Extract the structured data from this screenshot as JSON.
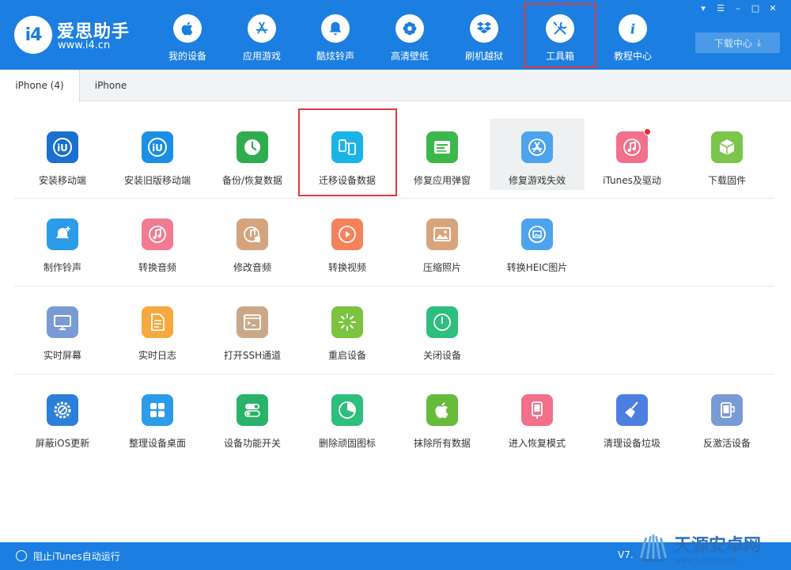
{
  "brand": {
    "name": "爱思助手",
    "url": "www.i4.cn",
    "logo_text": "i4"
  },
  "nav": [
    {
      "label": "我的设备",
      "icon": "apple-icon"
    },
    {
      "label": "应用游戏",
      "icon": "app-store-icon"
    },
    {
      "label": "酷炫铃声",
      "icon": "bell-icon"
    },
    {
      "label": "高清壁纸",
      "icon": "flower-icon"
    },
    {
      "label": "刷机越狱",
      "icon": "box-icon"
    },
    {
      "label": "工具箱",
      "icon": "tools-icon",
      "active": true
    },
    {
      "label": "教程中心",
      "icon": "info-icon"
    }
  ],
  "window_controls": [
    "shirt-icon",
    "menu-icon",
    "minimize-icon",
    "maximize-icon",
    "close-icon"
  ],
  "download_center": {
    "label": "下载中心"
  },
  "tabs": [
    {
      "label": "iPhone (4)",
      "active": true
    },
    {
      "label": "iPhone",
      "active": false
    }
  ],
  "tools": {
    "row1": [
      {
        "label": "安装移动端",
        "icon": "i4-icon",
        "color": "#1a6fcf"
      },
      {
        "label": "安装旧版移动端",
        "icon": "i4-icon",
        "color": "#1b8fe6"
      },
      {
        "label": "备份/恢复数据",
        "icon": "backup-clock-icon",
        "color": "#2fad4e"
      },
      {
        "label": "迁移设备数据",
        "icon": "phone-transfer-icon",
        "color": "#19b4e8"
      },
      {
        "label": "修复应用弹窗",
        "icon": "apple-id-icon",
        "color": "#3bb84a"
      },
      {
        "label": "修复游戏失效",
        "icon": "app-store-icon",
        "color": "#4ea3ee"
      },
      {
        "label": "iTunes及驱动",
        "icon": "music-settings-icon",
        "color": "#f27089",
        "badge": true
      },
      {
        "label": "下载固件",
        "icon": "cube-icon",
        "color": "#7ac54a"
      }
    ],
    "row2": [
      {
        "label": "制作铃声",
        "icon": "bell-plus-icon",
        "color": "#2c9be8"
      },
      {
        "label": "转换音频",
        "icon": "music-note-icon",
        "color": "#f27b92"
      },
      {
        "label": "修改音频",
        "icon": "music-edit-icon",
        "color": "#d3a47e"
      },
      {
        "label": "转换视频",
        "icon": "play-icon",
        "color": "#f5825a"
      },
      {
        "label": "压缩照片",
        "icon": "photo-icon",
        "color": "#d9a47a"
      },
      {
        "label": "转换HEIC图片",
        "icon": "image-convert-icon",
        "color": "#4ea3ee"
      }
    ],
    "row3": [
      {
        "label": "实时屏幕",
        "icon": "monitor-icon",
        "color": "#7a9ad6"
      },
      {
        "label": "实时日志",
        "icon": "document-icon",
        "color": "#f5a93e"
      },
      {
        "label": "打开SSH通道",
        "icon": "terminal-icon",
        "color": "#c9a88a"
      },
      {
        "label": "重启设备",
        "icon": "loading-icon",
        "color": "#7cc43f"
      },
      {
        "label": "关闭设备",
        "icon": "power-icon",
        "color": "#2dbf7d"
      }
    ],
    "row4": [
      {
        "label": "屏蔽iOS更新",
        "icon": "gear-block-icon",
        "color": "#2c7fd9"
      },
      {
        "label": "整理设备桌面",
        "icon": "grid-icon",
        "color": "#2c9be8"
      },
      {
        "label": "设备功能开关",
        "icon": "toggle-icon",
        "color": "#29b269"
      },
      {
        "label": "删除顽固图标",
        "icon": "pie-icon",
        "color": "#2dbf7d"
      },
      {
        "label": "抹除所有数据",
        "icon": "apple-icon",
        "color": "#66bb3a"
      },
      {
        "label": "进入恢复模式",
        "icon": "phone-recovery-icon",
        "color": "#f27089"
      },
      {
        "label": "清理设备垃圾",
        "icon": "broom-icon",
        "color": "#4d7fe0"
      },
      {
        "label": "反激活设备",
        "icon": "deactivate-icon",
        "color": "#7a9ad6"
      }
    ]
  },
  "footer": {
    "itunes_block": "阻止iTunes自动运行",
    "version": "V7."
  },
  "watermark": {
    "title": "天源安卓网",
    "url": "www.jytyaz.com"
  },
  "colors": {
    "header": "#1b7ee0",
    "highlight_box": "#e0393e"
  }
}
